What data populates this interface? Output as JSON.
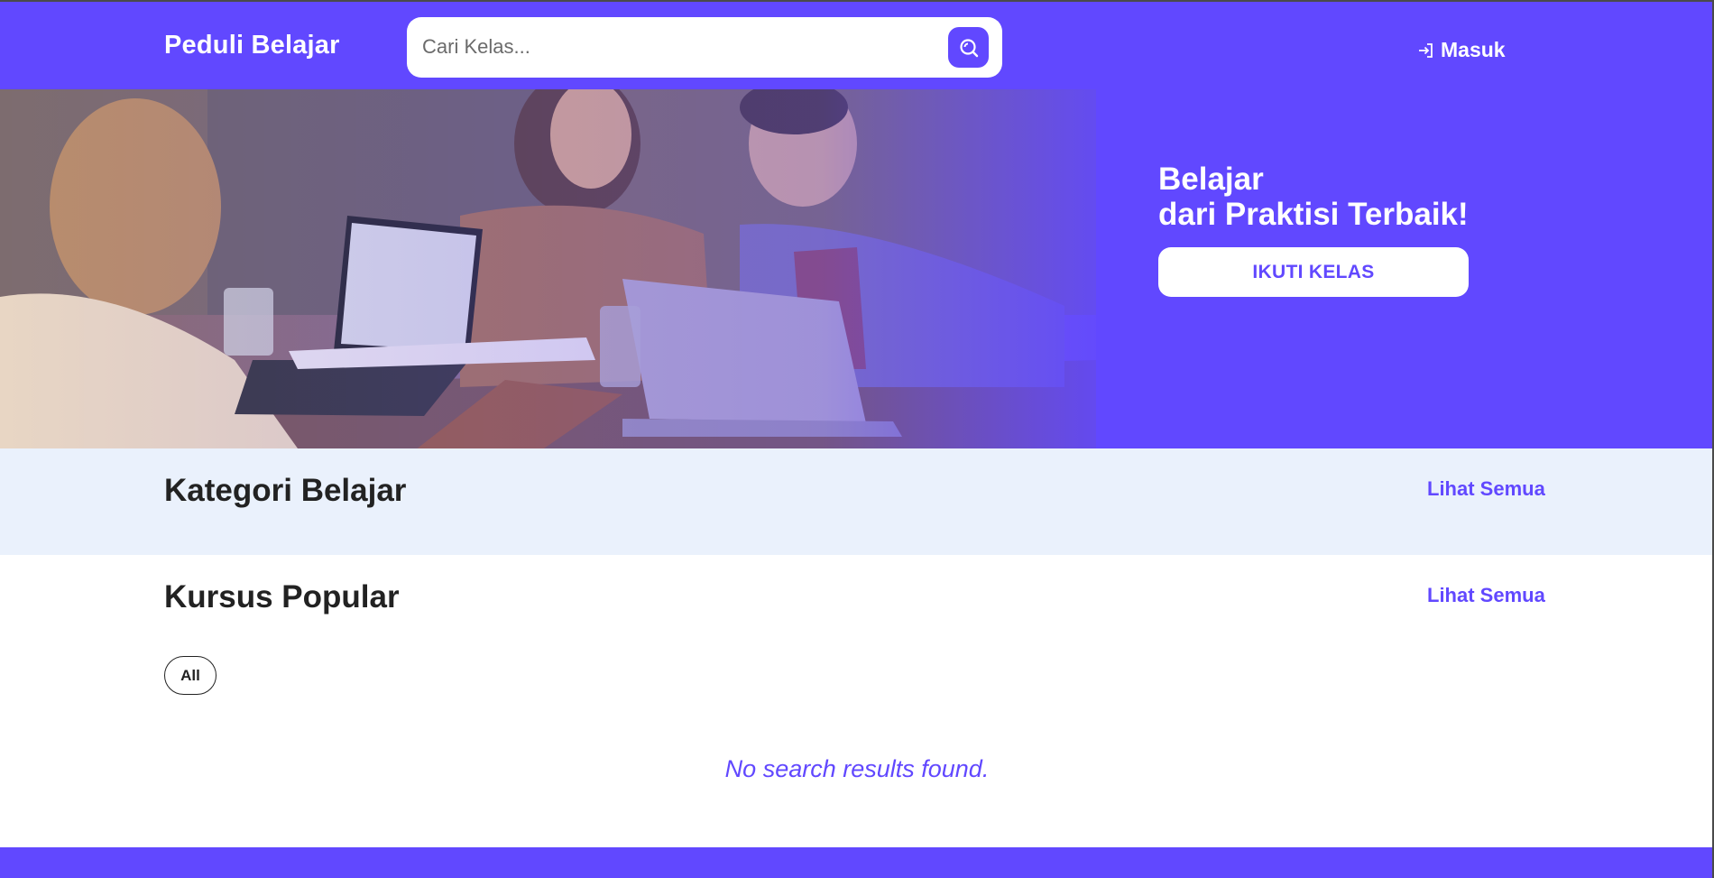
{
  "header": {
    "brand": "Peduli Belajar",
    "search_placeholder": "Cari Kelas...",
    "login_label": "Masuk"
  },
  "hero": {
    "title_line1": "Belajar",
    "title_line2": "dari Praktisi Terbaik!",
    "cta_label": "IKUTI KELAS"
  },
  "kategori": {
    "title": "Kategori Belajar",
    "see_all": "Lihat Semua"
  },
  "kursus": {
    "title": "Kursus Popular",
    "see_all": "Lihat Semua",
    "filters": [
      "All"
    ],
    "empty_message": "No search results found."
  },
  "colors": {
    "primary": "#6148ff",
    "section_bg": "#eaf1fc",
    "white": "#ffffff"
  }
}
